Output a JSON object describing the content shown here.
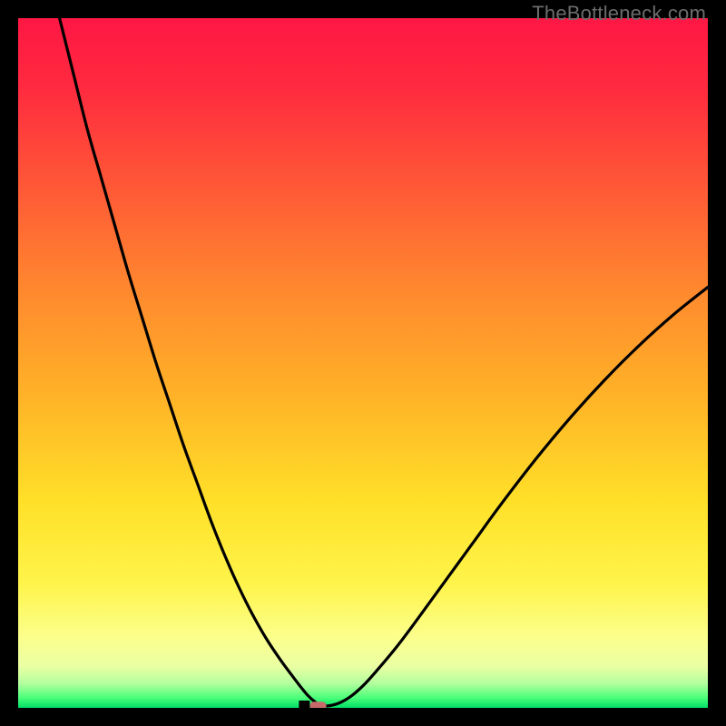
{
  "watermark": "TheBottleneck.com",
  "colors": {
    "black": "#000000",
    "curve": "#000000",
    "marker": "#c96a6a",
    "gradient_stops": [
      {
        "offset": 0.0,
        "color": "#ff1744"
      },
      {
        "offset": 0.1,
        "color": "#ff2a3f"
      },
      {
        "offset": 0.25,
        "color": "#ff5a36"
      },
      {
        "offset": 0.4,
        "color": "#ff8a2e"
      },
      {
        "offset": 0.55,
        "color": "#ffb327"
      },
      {
        "offset": 0.7,
        "color": "#ffe028"
      },
      {
        "offset": 0.82,
        "color": "#fff44a"
      },
      {
        "offset": 0.9,
        "color": "#fbff8e"
      },
      {
        "offset": 0.94,
        "color": "#eaffa3"
      },
      {
        "offset": 0.965,
        "color": "#b2ff9e"
      },
      {
        "offset": 0.985,
        "color": "#4dff7a"
      },
      {
        "offset": 1.0,
        "color": "#00e067"
      }
    ]
  },
  "chart_data": {
    "type": "line",
    "title": "",
    "xlabel": "",
    "ylabel": "",
    "x_range": [
      0,
      100
    ],
    "y_range": [
      0,
      100
    ],
    "x": [
      6,
      8,
      10,
      12,
      14,
      16,
      18,
      20,
      22,
      24,
      26,
      28,
      30,
      32,
      34,
      36,
      38,
      40,
      41,
      42,
      43,
      44,
      46,
      48,
      50,
      52,
      55,
      58,
      62,
      66,
      70,
      75,
      80,
      85,
      90,
      95,
      100
    ],
    "values": [
      100,
      92,
      84,
      77,
      70,
      63,
      56.5,
      50,
      44,
      38,
      32.5,
      27,
      22,
      17.5,
      13.5,
      10,
      7,
      4.3,
      3,
      1.8,
      0.9,
      0.3,
      0.5,
      1.5,
      3.2,
      5.4,
      9,
      13,
      18.5,
      24,
      29.5,
      36,
      42,
      47.5,
      52.5,
      57,
      61
    ],
    "marker": {
      "x": 43.5,
      "y": 0.3
    },
    "notch_x_pct": 41.5
  }
}
